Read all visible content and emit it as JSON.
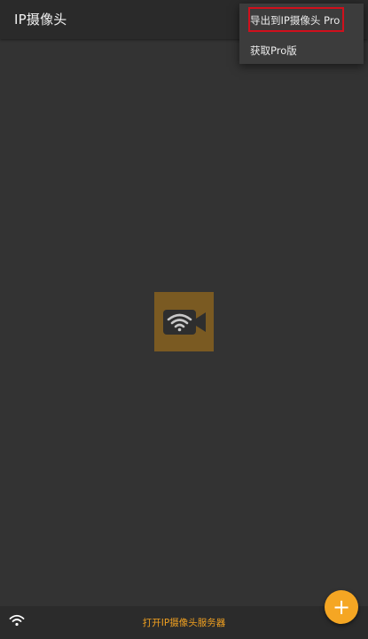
{
  "appbar": {
    "title": "IP摄像头"
  },
  "overflow_menu": {
    "items": [
      {
        "label": "导出到IP摄像头 Pro"
      },
      {
        "label": "获取Pro版"
      }
    ]
  },
  "center_logo": {
    "icon": "wifi-camera-icon",
    "tile_color": "#7a5a22"
  },
  "bottombar": {
    "wifi_icon": "wifi-icon",
    "open_server_label": "打开IP摄像头服务器"
  },
  "fab": {
    "icon": "plus-icon",
    "label": "+",
    "color": "#f5a623"
  },
  "colors": {
    "background": "#333333",
    "appbar": "#2a2a2a",
    "accent": "#f0a020",
    "highlight": "#d0101c"
  }
}
